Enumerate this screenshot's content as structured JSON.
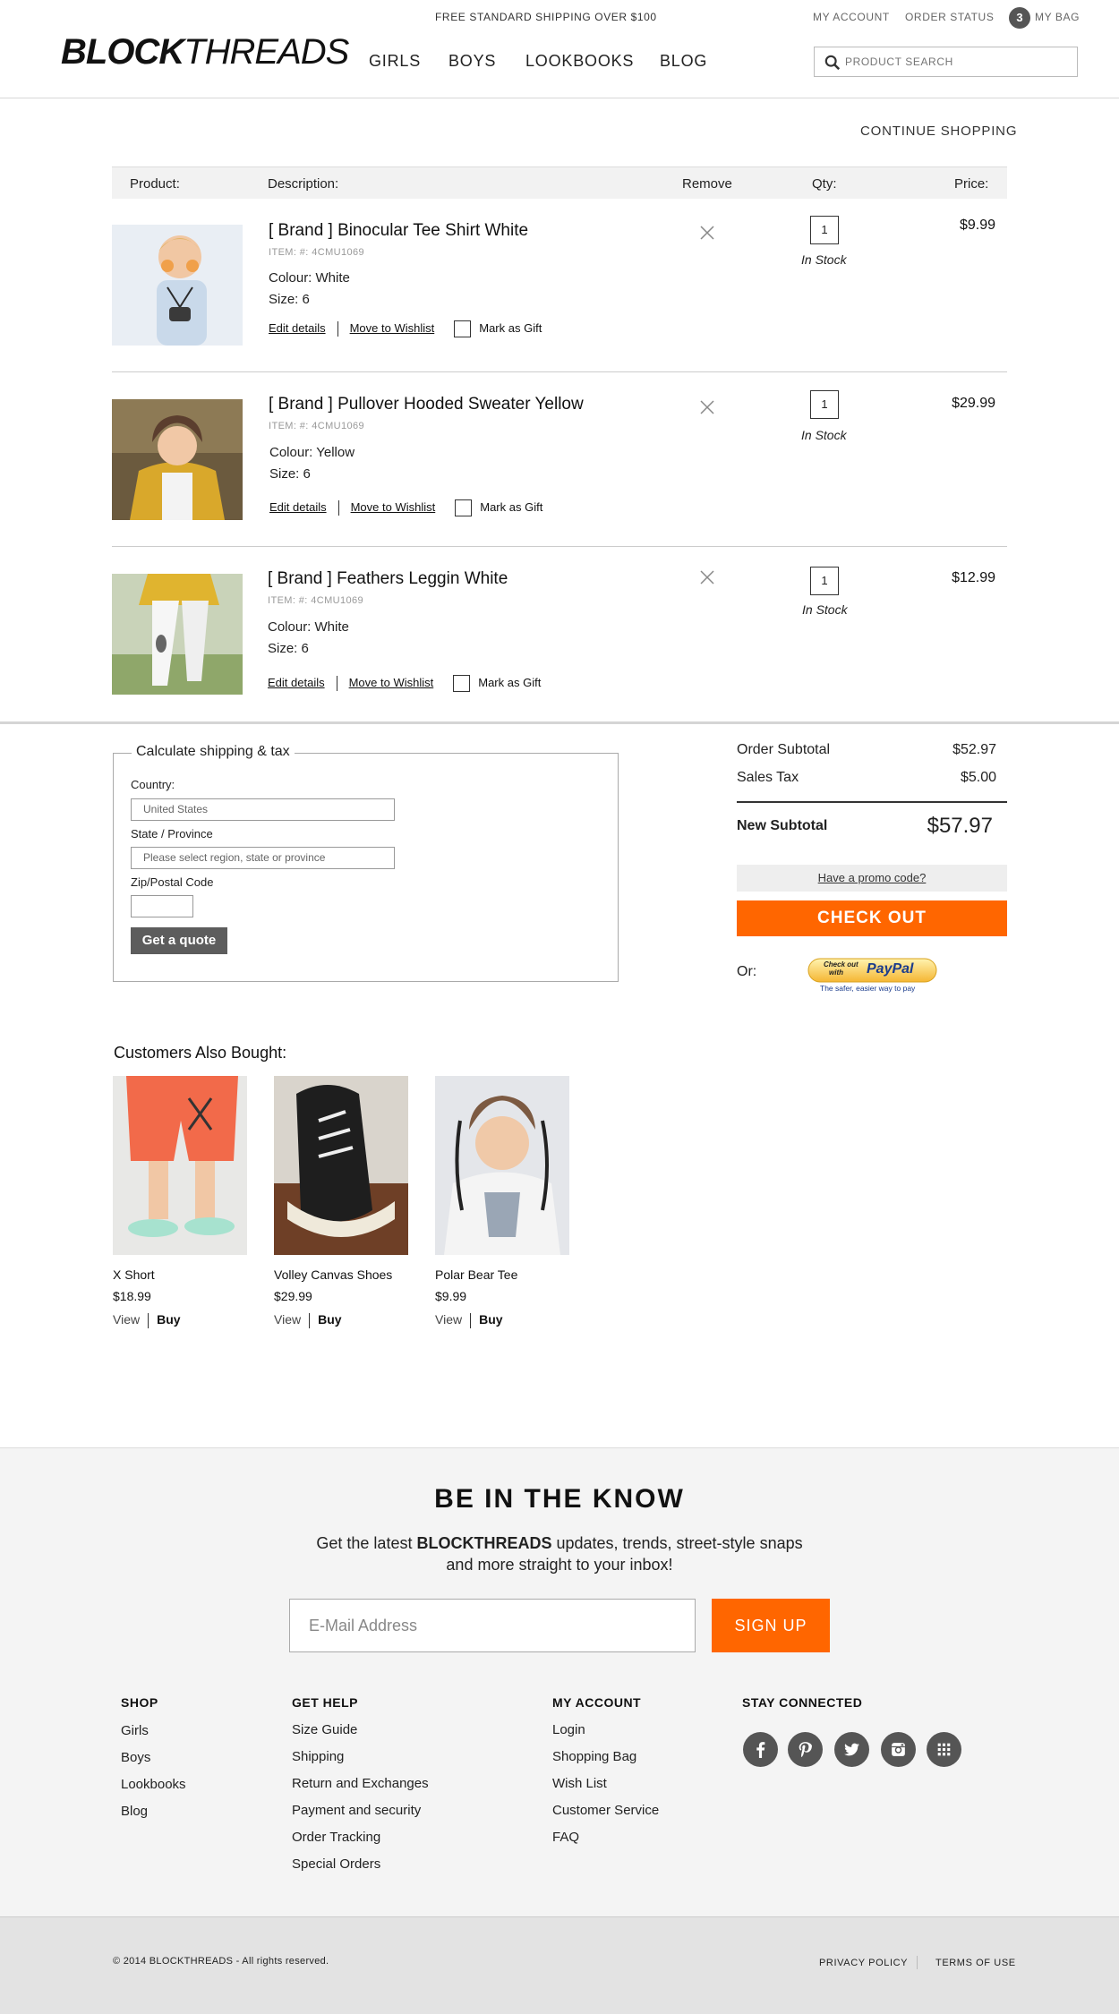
{
  "header": {
    "promo": "FREE STANDARD SHIPPING OVER $100",
    "logo_bold": "BLOCK",
    "logo_light": "THREADS",
    "my_account": "MY ACCOUNT",
    "order_status": "ORDER STATUS",
    "bag_count": "3",
    "my_bag": "MY BAG",
    "nav": [
      "GIRLS",
      "BOYS",
      "LOOKBOOKS",
      "BLOG"
    ],
    "search_placeholder": "PRODUCT SEARCH"
  },
  "continue_shopping": "CONTINUE SHOPPING",
  "table_headers": {
    "product": "Product:",
    "description": "Description:",
    "remove": "Remove",
    "qty": "Qty:",
    "price": "Price:"
  },
  "cart_items": [
    {
      "name": "[ Brand ] Binocular Tee Shirt White",
      "sku": "ITEM:  #: 4CMU1069",
      "colour": "Colour: White",
      "size": "Size: 6",
      "qty": "1",
      "stock": "In Stock",
      "price": "$9.99"
    },
    {
      "name": "[ Brand ] Pullover Hooded Sweater Yellow",
      "sku": "ITEM:  #: 4CMU1069",
      "colour": "Colour: Yellow",
      "size": "Size: 6",
      "qty": "1",
      "stock": "In Stock",
      "price": "$29.99"
    },
    {
      "name": "[ Brand ] Feathers Leggin White",
      "sku": "ITEM:  #: 4CMU1069",
      "colour": "Colour: White",
      "size": "Size: 6",
      "qty": "1",
      "stock": "In Stock",
      "price": "$12.99"
    }
  ],
  "item_actions": {
    "edit": "Edit details",
    "wishlist": "Move to Wishlist",
    "gift": "Mark as Gift"
  },
  "shipping_calc": {
    "legend": "Calculate shipping & tax",
    "country_label": "Country:",
    "country_value": "United States",
    "state_label": "State / Province",
    "state_placeholder": "Please select region, state or province",
    "zip_label": "Zip/Postal Code",
    "quote_button": "Get a quote"
  },
  "summary": {
    "subtotal_label": "Order Subtotal",
    "subtotal_value": "$52.97",
    "tax_label": "Sales Tax",
    "tax_value": "$5.00",
    "new_subtotal_label": "New Subtotal",
    "new_subtotal_value": "$57.97",
    "promo_link": "Have a promo code?",
    "checkout": "CHECK OUT",
    "or": "Or:",
    "paypal_line1": "Check out",
    "paypal_line2": "with",
    "paypal_brand": "PayPal",
    "paypal_tag": "The safer, easier way to pay"
  },
  "also_bought": {
    "title": "Customers Also Bought:",
    "view": "View",
    "buy": "Buy",
    "items": [
      {
        "name": "X Short",
        "price": "$18.99"
      },
      {
        "name": "Volley Canvas Shoes",
        "price": "$29.99"
      },
      {
        "name": "Polar Bear Tee",
        "price": "$9.99"
      }
    ]
  },
  "newsletter": {
    "title": "BE IN THE KNOW",
    "text_pre": "Get the latest ",
    "text_brand": "BLOCKTHREADS",
    "text_post": " updates, trends, street-style snaps",
    "text_line2": "and more straight to your inbox!",
    "email_placeholder": "E-Mail Address",
    "signup": "SIGN UP"
  },
  "footer": {
    "shop_title": "SHOP",
    "shop_links": [
      "Girls",
      "Boys",
      "Lookbooks",
      "Blog"
    ],
    "help_title": "GET HELP",
    "help_links": [
      "Size Guide",
      "Shipping",
      "Return and Exchanges",
      "Payment and security",
      "Order Tracking",
      "Special Orders"
    ],
    "account_title": "MY ACCOUNT",
    "account_links": [
      "Login",
      "Shopping Bag",
      "Wish List",
      "Customer Service",
      "FAQ"
    ],
    "social_title": "STAY CONNECTED",
    "social_icons": [
      "facebook-icon",
      "pinterest-icon",
      "twitter-icon",
      "instagram-icon",
      "grid-icon"
    ],
    "copyright": "© 2014 BLOCKTHREADS - All rights reserved.",
    "privacy": "PRIVACY POLICY",
    "terms": "TERMS OF USE"
  },
  "colors": {
    "accent": "#ff6600",
    "dark_button": "#5d5d5d",
    "footer_bg": "#f4f4f4"
  }
}
